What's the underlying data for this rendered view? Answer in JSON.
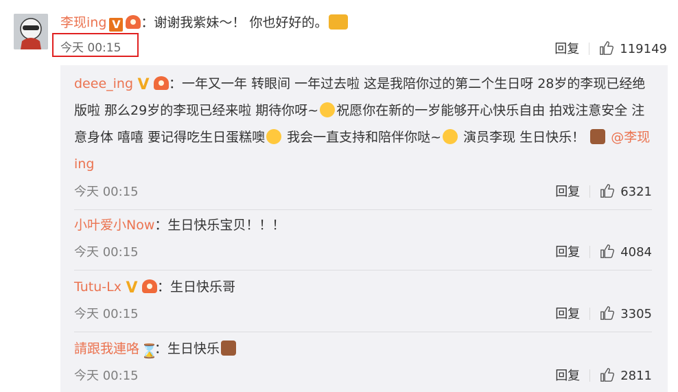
{
  "main_comment": {
    "author": "李现ing",
    "separator": "：",
    "text": "谢谢我紫妹～！ 你也好好的。",
    "time": "今天 00:15",
    "reply_label": "回复",
    "likes": "119149"
  },
  "replies": [
    {
      "author": "deee_ing",
      "separator": "：",
      "text_parts": [
        "一年又一年 转眼间 一年过去啦 这是我陪你过的第二个生日呀 28岁的李现已经绝版啦 那么29岁的李现已经来啦 期待你呀~",
        "祝愿你在新的一岁能够开心快乐自由 拍戏注意安全 注意身体 嘻嘻 要记得吃生日蛋糕噢",
        " 我会一直支持和陪伴你哒~",
        " 演员李现 生日快乐！ ",
        " "
      ],
      "mention": "@李现ing",
      "time": "今天 00:15",
      "reply_label": "回复",
      "likes": "6321"
    },
    {
      "author": "小叶爱小Now",
      "separator": "：",
      "text": "生日快乐宝贝！！！",
      "time": "今天 00:15",
      "reply_label": "回复",
      "likes": "4084"
    },
    {
      "author": "Tutu-Lx",
      "separator": "：",
      "text": "生日快乐哥",
      "time": "今天 00:15",
      "reply_label": "回复",
      "likes": "3305"
    },
    {
      "author": "請跟我連咯",
      "separator": "：",
      "text": "生日快乐",
      "time": "今天 00:15",
      "reply_label": "回复",
      "likes": "2811"
    }
  ],
  "icons": {
    "verified_orange": "verified-v-icon",
    "verified_gold": "verified-gold-v-icon",
    "fan_badge": "fan-badge-icon",
    "like": "thumbs-up-icon",
    "hourglass": "hourglass-icon"
  },
  "colors": {
    "username": "#eb7350",
    "highlight_border": "#e02020",
    "reply_bg": "#f2f2f5"
  }
}
